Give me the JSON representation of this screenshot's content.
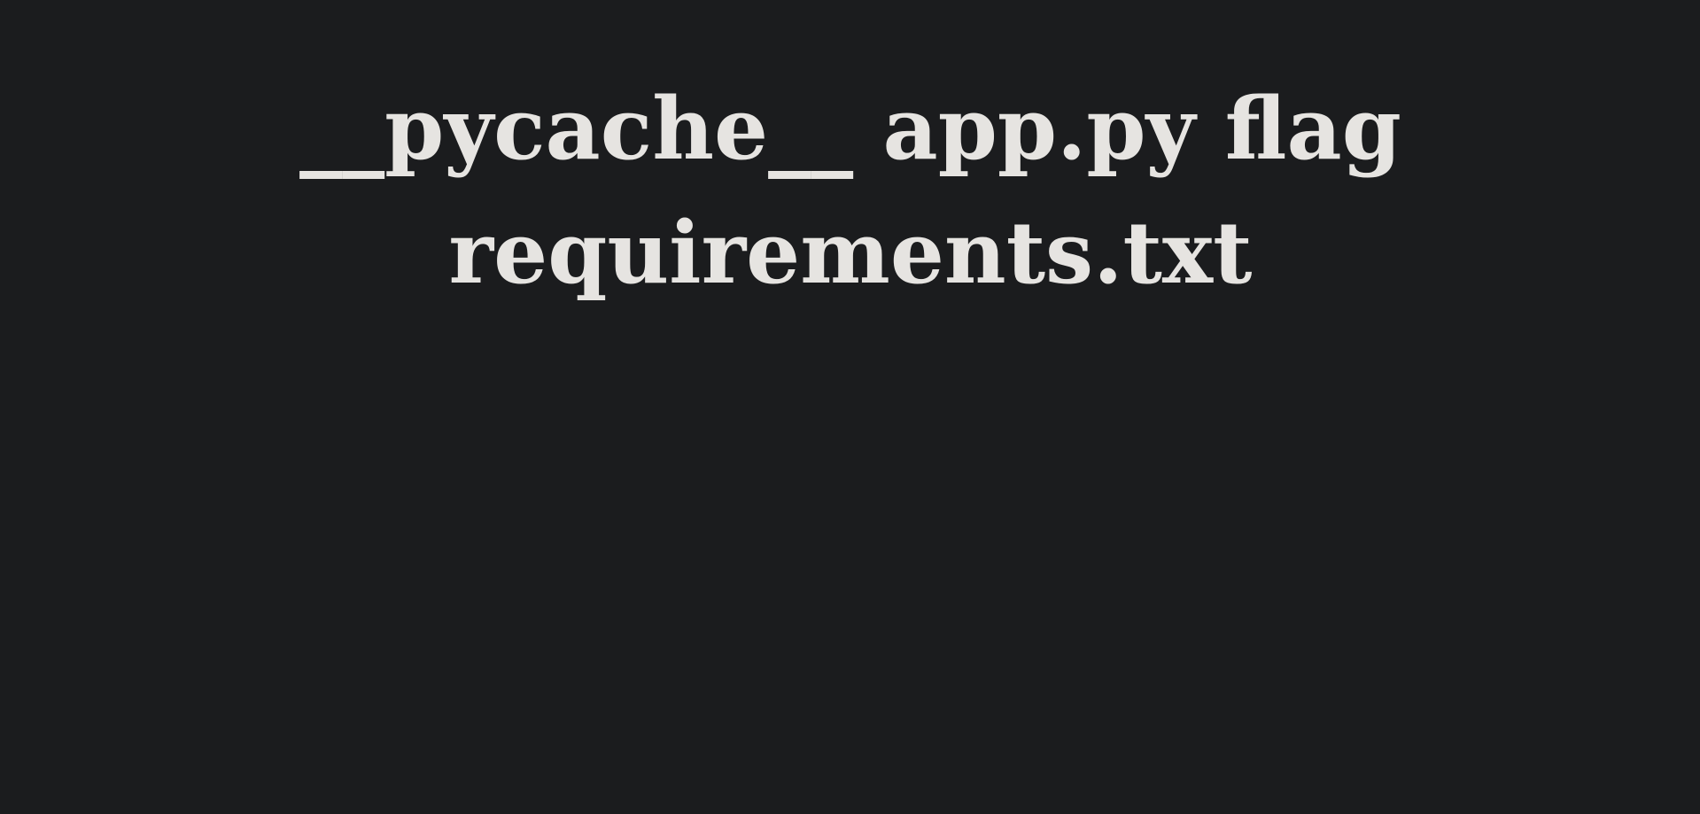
{
  "page": {
    "background_color": "#1b1c1e",
    "text_color": "#e6e4e1",
    "heading_text": "__pycache__ app.py flag requirements.txt"
  }
}
